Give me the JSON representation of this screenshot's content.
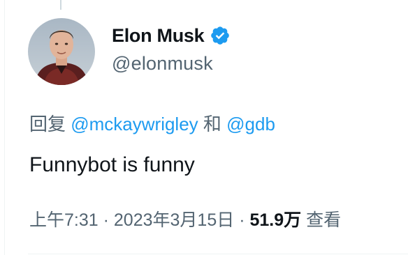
{
  "tweet": {
    "author": {
      "display_name": "Elon Musk",
      "handle": "@elonmusk",
      "verified": true,
      "avatar_icon": "profile-photo"
    },
    "reply_context": {
      "prefix": "回复",
      "mentions": [
        "@mckaywrigley",
        "@gdb"
      ],
      "joiner": "和"
    },
    "text": "Funnybot is funny",
    "meta": {
      "time": "上午7:31",
      "separator": "·",
      "date": "2023年3月15日",
      "views_count": "51.9万",
      "views_label": "查看"
    }
  },
  "colors": {
    "accent": "#1d9bf0",
    "primary_text": "#0f1419",
    "secondary_text": "#536471"
  }
}
